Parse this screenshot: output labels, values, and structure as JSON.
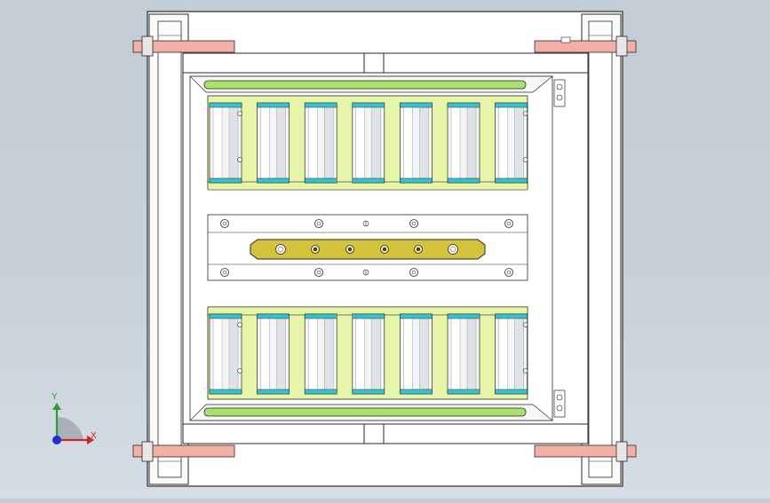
{
  "window": {
    "title": ""
  },
  "viewport": {
    "background_top": "#c4ccd6",
    "background_bottom": "#d6dde4"
  },
  "colors": {
    "frame_stroke": "#2a2a2a",
    "roller_accent": "#34c4d0",
    "roller_body": "#f4f4f4",
    "lime_panel": "#e6f5a8",
    "green_bar": "#a9e26a",
    "clamp_bar": "#d4c23a",
    "bracket_pink": "#f1b0a6"
  },
  "model": {
    "upper_roller_count": 7,
    "lower_roller_count": 7,
    "clamp_bar_holes": 6
  },
  "triad": {
    "x_label": "X",
    "y_label": "Y",
    "x_color": "#d0242a",
    "y_color": "#2e9a3a",
    "z_color": "#1e2fd6"
  }
}
